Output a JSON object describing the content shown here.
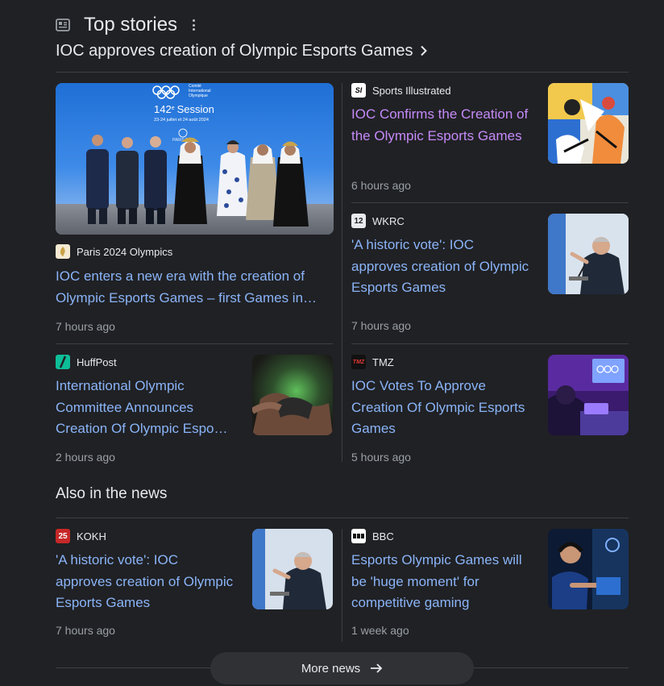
{
  "header": {
    "title": "Top stories",
    "story_title": "IOC approves creation of Olympic Esports Games"
  },
  "featured": {
    "image_text": {
      "brand1": "Comité",
      "brand2": "International",
      "brand3": "Olympique",
      "session": "142",
      "session_suffix": "e",
      "session_word": "Session",
      "dates": "23-24 juillet et 24 août 2024",
      "city": "PARIS 2024"
    },
    "source": "Paris 2024 Olympics",
    "headline": "IOC enters a new era with the creation of Olympic Esports Games – first Games in…",
    "time": "7 hours ago"
  },
  "stories": [
    {
      "source": "Sports Illustrated",
      "logo": "SI",
      "headline": "IOC Confirms the Creation of the Olympic Esports Games",
      "time": "6 hours ago"
    },
    {
      "source": "WKRC",
      "logo": "12",
      "headline": "'A historic vote': IOC approves creation of Olympic Esports Games",
      "time": "7 hours ago"
    },
    {
      "source": "HuffPost",
      "logo": "",
      "headline": "International Olympic Committee Announces Creation Of Olympic Espo…",
      "time": "2 hours ago"
    },
    {
      "source": "TMZ",
      "logo": "TMZ",
      "headline": "IOC Votes To Approve Creation Of Olympic Esports Games",
      "time": "5 hours ago"
    }
  ],
  "also": {
    "title": "Also in the news",
    "items": [
      {
        "source": "KOKH",
        "logo": "25",
        "headline": "'A historic vote': IOC approves creation of Olympic Esports Games",
        "time": "7 hours ago"
      },
      {
        "source": "BBC",
        "logo": "▪▪▪",
        "headline": "Esports Olympic Games will be 'huge moment' for competitive gaming",
        "time": "1 week ago"
      }
    ]
  },
  "more_news": "More news",
  "colors": {
    "link": "#8ab4f8",
    "visited": "#c58af9",
    "muted": "#9aa0a6",
    "bg": "#202124"
  }
}
